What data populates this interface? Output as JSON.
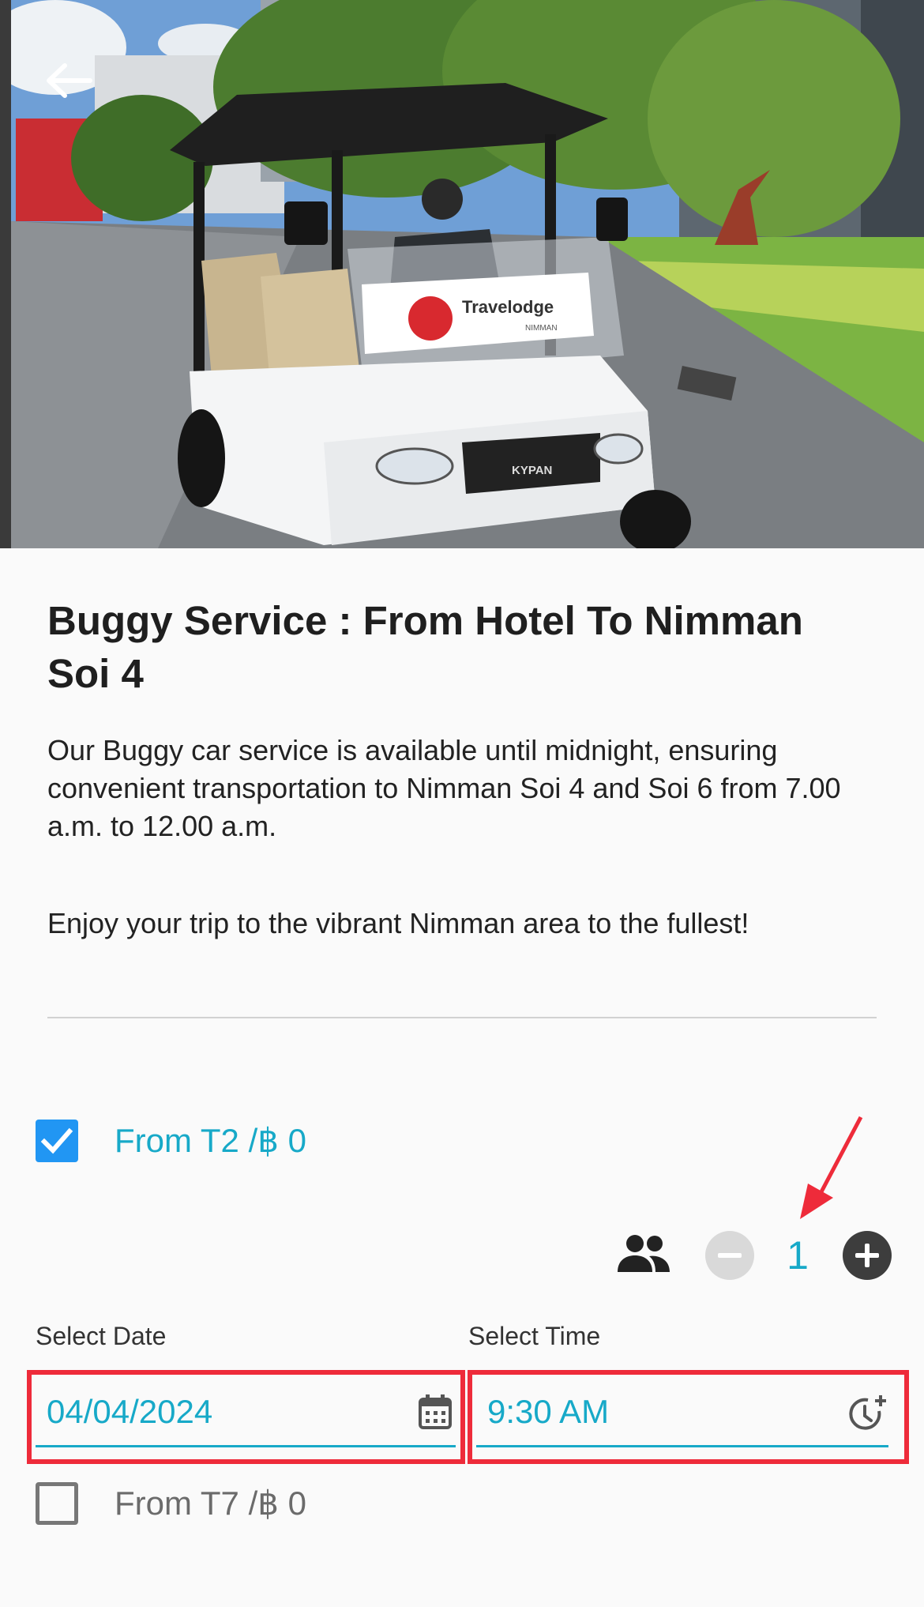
{
  "hero": {
    "photo": "golf-buggy-photo",
    "banner_brand": "Travelodge",
    "banner_sub": "NIMMAN",
    "vehicle_badge": "KYPAN"
  },
  "title": "Buggy Service : From Hotel To Nimman Soi 4",
  "description": "Our Buggy car service is available until midnight, ensuring convenient transportation to Nimman Soi 4 and Soi 6 from 7.00 a.m. to 12.00 a.m.",
  "tagline": "Enjoy your trip to the vibrant Nimman area to the fullest!",
  "options": [
    {
      "label": "From T2 /฿ 0",
      "checked": true,
      "pax": "1",
      "date_label": "Select Date",
      "date_value": "04/04/2024",
      "time_label": "Select Time",
      "time_value": "9:30 AM"
    },
    {
      "label": "From T7 /฿ 0",
      "checked": false
    }
  ],
  "icons": {
    "back": "arrow-left-icon",
    "people": "people-icon",
    "minus": "minus-circle-icon",
    "plus": "plus-circle-icon",
    "calendar": "calendar-icon",
    "clock": "clock-plus-icon"
  },
  "colors": {
    "accent": "#17a9c8",
    "checkbox": "#2196f3",
    "annotation": "#ee2b3a"
  }
}
